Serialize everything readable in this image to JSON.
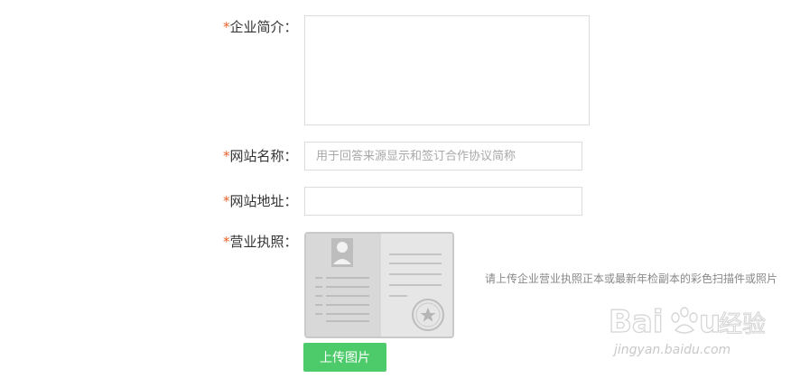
{
  "form": {
    "required_mark": "*",
    "intro": {
      "label": "企业简介：",
      "value": ""
    },
    "site_name": {
      "label": "网站名称：",
      "placeholder": "用于回答来源显示和签订合作协议简称",
      "value": ""
    },
    "site_url": {
      "label": "网站地址：",
      "placeholder": "",
      "value": ""
    },
    "license": {
      "label": "营业执照：",
      "hint": "请上传企业营业执照正本或最新年检副本的彩色扫描件或照片",
      "upload_button": "上传图片"
    }
  },
  "watermark": {
    "brand": "Baidu经验",
    "url": "jingyan.baidu.com"
  },
  "colors": {
    "required": "#e8612c",
    "upload_button": "#4dcb6a",
    "border": "#dcdcdc",
    "hint": "#888888"
  }
}
